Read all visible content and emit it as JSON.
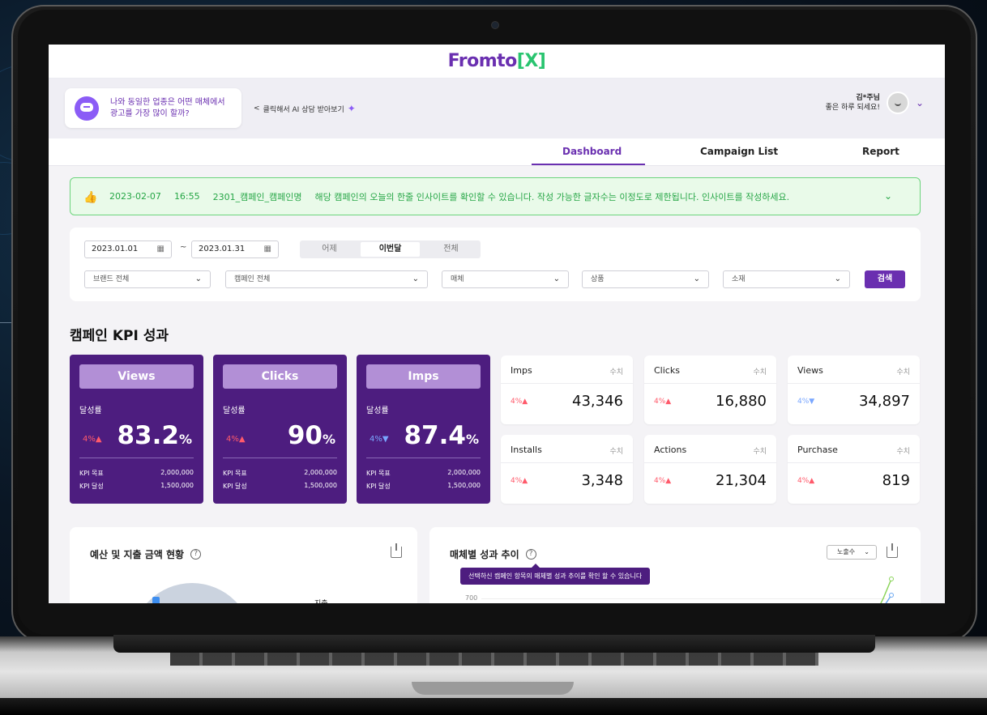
{
  "brand": {
    "logo_main": "Fromto",
    "logo_bracket_open": "[",
    "logo_x": "X",
    "logo_bracket_close": "]",
    "accent": "#6a2fb0",
    "green": "#29c46f"
  },
  "ai": {
    "question_line1": "나와 동일한 업종은 어떤 매체에서",
    "question_line2": "광고를 가장 많이 할까?",
    "link_arrow": "<",
    "link_text": "클릭해서 AI 상담 받아보기"
  },
  "user": {
    "name": "김*주님",
    "greeting": "좋은 하루 되세요!"
  },
  "nav": {
    "tabs": [
      {
        "label": "Dashboard",
        "active": true
      },
      {
        "label": "Campaign List"
      },
      {
        "label": "Report"
      }
    ]
  },
  "insight": {
    "date": "2023-02-07",
    "time": "16:55",
    "campaign": "2301_캠페인_캠페인명",
    "message": "해당 캠페인의 오늘의 한줄 인사이트를 확인할 수 있습니다. 작성 가능한 글자수는 이정도로 제한됩니다. 인사이트를 작성하세요."
  },
  "filter": {
    "start_date": "2023.01.01",
    "end_date": "2023.01.31",
    "tilde": "~",
    "range": [
      "어제",
      "이번달",
      "전체"
    ],
    "brand": "브랜드 전체",
    "campaign": "캠페인 전체",
    "media": "매체",
    "product": "상품",
    "material": "소재",
    "search": "검색"
  },
  "kpi": {
    "title": "캠페인 KPI 성과",
    "achieve_label": "달성률",
    "target_label": "KPI 목표",
    "actual_label": "KPI 달성",
    "percent_sign": "%",
    "cards": [
      {
        "name": "Views",
        "change": "4%",
        "trend": "up",
        "rate": "83.2",
        "target": "2,000,000",
        "actual": "1,500,000"
      },
      {
        "name": "Clicks",
        "change": "4%",
        "trend": "up",
        "rate": "90",
        "target": "2,000,000",
        "actual": "1,500,000"
      },
      {
        "name": "Imps",
        "change": "4%",
        "trend": "down",
        "rate": "87.4",
        "target": "2,000,000",
        "actual": "1,500,000"
      }
    ],
    "metric_unit": "수치",
    "metrics": [
      {
        "name": "Imps",
        "change": "4%",
        "trend": "up",
        "value": "43,346"
      },
      {
        "name": "Clicks",
        "change": "4%",
        "trend": "up",
        "value": "16,880"
      },
      {
        "name": "Views",
        "change": "4%",
        "trend": "down",
        "value": "34,897"
      },
      {
        "name": "Installs",
        "change": "4%",
        "trend": "up",
        "value": "3,348"
      },
      {
        "name": "Actions",
        "change": "4%",
        "trend": "up",
        "value": "21,304"
      },
      {
        "name": "Purchase",
        "change": "4%",
        "trend": "up",
        "value": "819"
      }
    ]
  },
  "budget": {
    "title": "예산 및 지출 금액 현황",
    "help": "?",
    "legend_spend": "지출"
  },
  "media_trend": {
    "title": "매체별 성과 추이",
    "help": "?",
    "tooltip": "선택하신 캠페인 항목의 매체별 성과 추이를 확인 할 수 있습니다",
    "metric_select": "노출수",
    "ytick": "700"
  }
}
